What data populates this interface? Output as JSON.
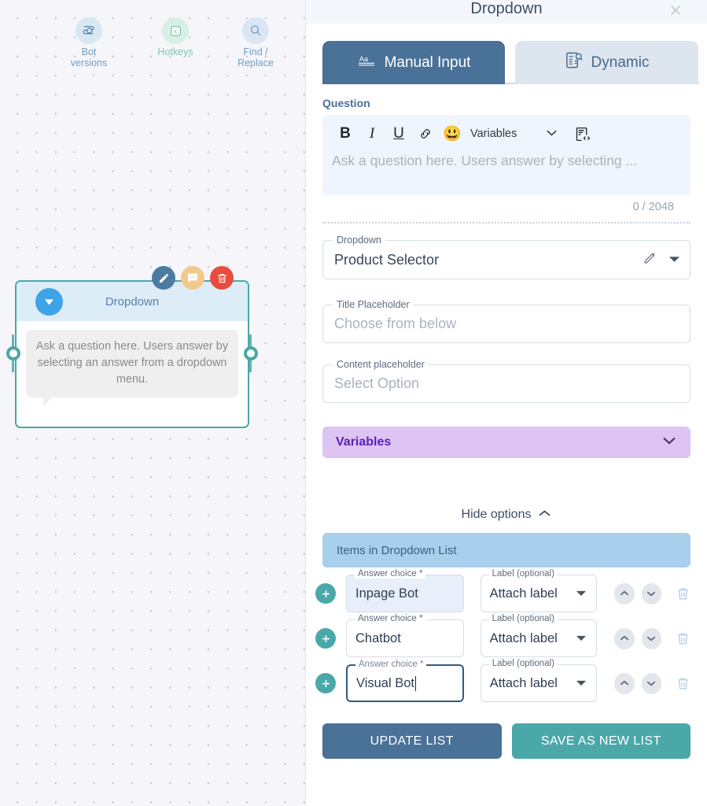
{
  "canvas": {
    "tools": [
      {
        "label": "Bot\nversions",
        "icon": "bot-versions-icon"
      },
      {
        "label": "Hotkeys",
        "icon": "hotkeys-icon"
      },
      {
        "label": "Find /\nReplace",
        "icon": "find-replace-icon"
      }
    ],
    "tool_labels": {
      "bot_versions_line1": "Bot",
      "bot_versions_line2": "versions",
      "hotkeys": "Hotkeys",
      "find_replace_line1": "Find /",
      "find_replace_line2": "Replace"
    },
    "node": {
      "title": "Dropdown",
      "body_text": "Ask a question here. Users answer by selecting an answer from a dropdown menu.",
      "actions": [
        "edit-icon",
        "comment-icon",
        "delete-icon"
      ],
      "accent_color": "#4aa8a8",
      "header_color": "#dcedf7",
      "icon_color": "#3ea3e8"
    }
  },
  "panel": {
    "title": "Dropdown",
    "close_label": "×",
    "tabs": [
      {
        "label": "Manual Input",
        "icon": "text-format-icon",
        "active": true
      },
      {
        "label": "Dynamic",
        "icon": "dynamic-data-icon",
        "active": false
      }
    ],
    "question": {
      "section_label": "Question",
      "toolbar": {
        "bold": "B",
        "italic": "I",
        "underline": "U",
        "link": "link-icon",
        "emoji": "😃",
        "variables_label": "Variables",
        "code_icon": "code-view-icon"
      },
      "placeholder": "Ask a question here. Users answer by selecting ...",
      "char_count": "0 / 2048"
    },
    "dropdown_field": {
      "label": "Dropdown",
      "value": "Product Selector",
      "actions": [
        "pencil-icon",
        "caret-down-icon"
      ]
    },
    "title_placeholder_field": {
      "label": "Title Placeholder",
      "placeholder": "Choose from below"
    },
    "content_placeholder_field": {
      "label": "Content placeholder",
      "placeholder": "Select Option"
    },
    "variables_bar": {
      "label": "Variables",
      "color": "#ddc4f3",
      "text_color": "#5b21b6"
    },
    "hide_options": {
      "label": "Hide options",
      "icon": "chevron-up-icon"
    },
    "items_header": {
      "label": "Items in Dropdown List",
      "color": "#a8cfec"
    },
    "answer_rows": [
      {
        "choice_label": "Answer choice *",
        "choice_value": "Inpage Bot",
        "label_label": "Label (optional)",
        "label_value": "Attach label",
        "state": "filled"
      },
      {
        "choice_label": "Answer choice *",
        "choice_value": "Chatbot",
        "label_label": "Label (optional)",
        "label_value": "Attach label",
        "state": "normal"
      },
      {
        "choice_label": "Answer choice *",
        "choice_value": "Visual Bot",
        "label_label": "Label (optional)",
        "label_value": "Attach label",
        "state": "focused"
      }
    ],
    "footer": {
      "update_label": "UPDATE LIST",
      "save_as_new_label": "SAVE AS NEW LIST"
    }
  }
}
